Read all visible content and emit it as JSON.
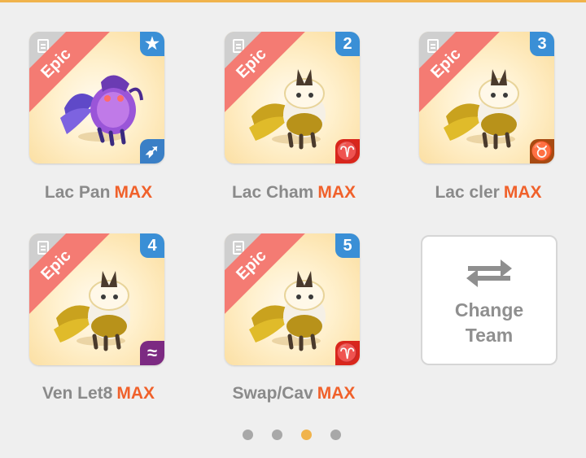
{
  "colors": {
    "accent": "#f0b34c",
    "max": "#f0612b",
    "rarity_ribbon": "#f47b73",
    "number_badge": "#3a8fd6",
    "active_dot": "#f0b34c",
    "inactive_dot": "#a8a8a8"
  },
  "cards": [
    {
      "name": "Lac Pan",
      "level": "MAX",
      "rarity": "Epic",
      "badge": "★",
      "element_icon": "arrow-icon",
      "element_color": "#3a7fc6",
      "element_glyph": "➶",
      "creature": "purple"
    },
    {
      "name": "Lac Cham",
      "level": "MAX",
      "rarity": "Epic",
      "badge": "2",
      "element_icon": "aries-icon",
      "element_color": "#d9261c",
      "element_glyph": "♈",
      "creature": "gold"
    },
    {
      "name": "Lac cler",
      "level": "MAX",
      "rarity": "Epic",
      "badge": "3",
      "element_icon": "taurus-icon",
      "element_color": "#a84a12",
      "element_glyph": "♉",
      "creature": "gold"
    },
    {
      "name": "Ven Let8",
      "level": "MAX",
      "rarity": "Epic",
      "badge": "4",
      "element_icon": "aquarius-icon",
      "element_color": "#7c2a82",
      "element_glyph": "≈",
      "creature": "gold"
    },
    {
      "name": "Swap/Cav",
      "level": "MAX",
      "rarity": "Epic",
      "badge": "5",
      "element_icon": "aries-icon",
      "element_color": "#d9261c",
      "element_glyph": "♈",
      "creature": "gold"
    }
  ],
  "change_team": {
    "line1": "Change",
    "line2": "Team",
    "icon": "swap-arrows-icon"
  },
  "pager": {
    "count": 4,
    "active_index": 2
  }
}
